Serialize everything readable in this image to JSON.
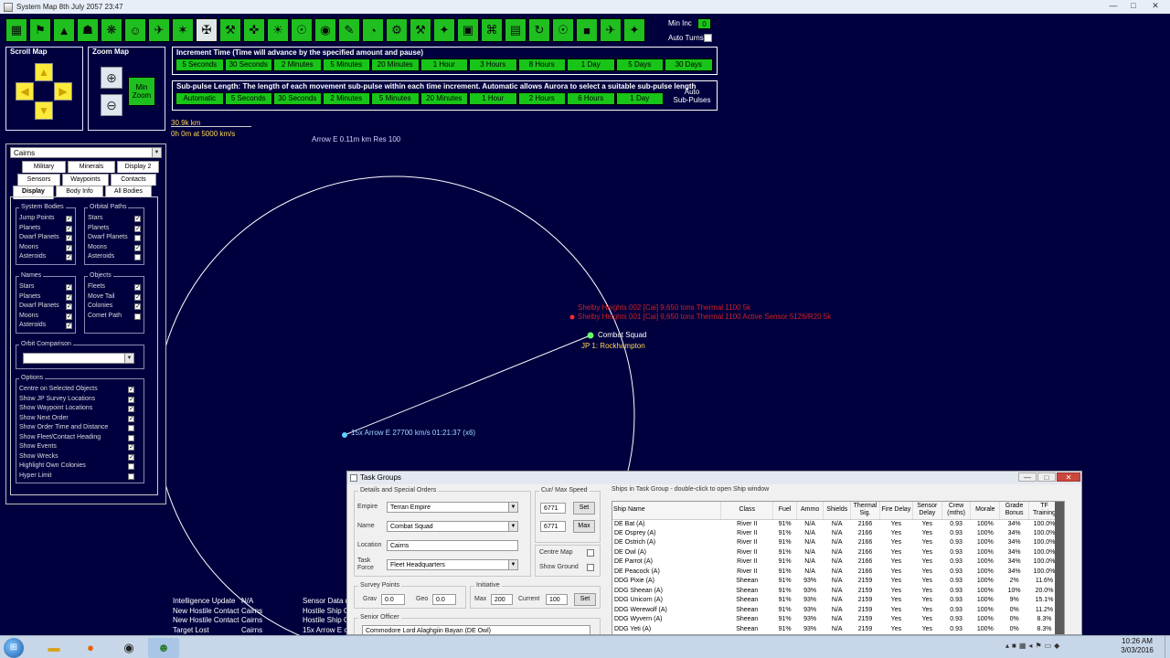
{
  "window": {
    "title": "System Map  8th July 2057 23:47",
    "min_label": "—",
    "max_label": "□",
    "close_label": "✕"
  },
  "toolbar": {
    "icons": [
      "colony-icon",
      "industry-icon",
      "shipyard-icon",
      "research-icon",
      "planet-icon",
      "commander-icon",
      "ship-design-icon",
      "missile-icon",
      "fighter-icon",
      "turret-icon",
      "crosshair-icon",
      "sun-icon",
      "survey-icon",
      "alien-icon",
      "intel-icon",
      "globe-icon",
      "ground-unit-icon",
      "hammer-icon",
      "fleet-icon",
      "class-icon",
      "tech-icon",
      "minerals-icon",
      "events-icon",
      "contacts-icon",
      "pause-icon",
      "fleet-move-icon",
      "theme-icon"
    ],
    "glyphs": [
      "▦",
      "⚑",
      "▲",
      "☗",
      "❋",
      "☺",
      "✈",
      "✶",
      "✠",
      "⚒",
      "✜",
      "☀",
      "☉",
      "◉",
      "✎",
      "◔",
      "⚙",
      "⚒",
      "✦",
      "▣",
      "⌘",
      "▤",
      "↻",
      "☉",
      "■",
      "✈",
      "✦"
    ]
  },
  "min_inc": {
    "label": "Min Inc",
    "value": "0"
  },
  "auto_turns": {
    "label": "Auto Turns"
  },
  "scroll_map": {
    "title": "Scroll Map"
  },
  "zoom_map": {
    "title": "Zoom Map",
    "min_zoom": "Min\nZoom"
  },
  "increment": {
    "title": "Increment Time (Time will advance by the specified amount and pause)",
    "buttons": [
      "5 Seconds",
      "30 Seconds",
      "2 Minutes",
      "5 Minutes",
      "20 Minutes",
      "1 Hour",
      "3 Hours",
      "8 Hours",
      "1 Day",
      "5 Days",
      "30 Days"
    ]
  },
  "subpulse": {
    "title": "Sub-pulse Length: The length of each movement sub-pulse within each time increment. Automatic allows Aurora to select a suitable sub-pulse length",
    "buttons": [
      "Automatic",
      "5 Seconds",
      "30 Seconds",
      "2 Minutes",
      "5 Minutes",
      "20 Minutes",
      "1 Hour",
      "2 Hours",
      "6 Hours",
      "1 Day"
    ],
    "auto_label": "Auto\nSub-Pulses"
  },
  "scale": {
    "distance": "30.9k km",
    "time": "0h 0m at 5000 km/s"
  },
  "map": {
    "arrow_label": "Arrow E  0.11m km  Res 100",
    "contact1": "Shelby Heights 002  [Cai]  9,650 tons  Thermal 1100  5k",
    "contact2": "Shelby Heights 001  [Cai]  9,650 tons  Thermal 1100  Active Sensor 5126/R20  5k",
    "fleet_label": "Combat Squad",
    "jp_label": "JP 1: Rockhampton",
    "missile_label": "15x Arrow E  27700 km/s  01:21:37 (x6)"
  },
  "left_panel": {
    "system": "Cairns",
    "tabs_row1": [
      "Military",
      "Minerals",
      "Display 2"
    ],
    "tabs_row2": [
      "Sensors",
      "Waypoints",
      "Contacts"
    ],
    "tabs_row3": [
      "Display",
      "Body Info",
      "All Bodies"
    ],
    "system_bodies": {
      "title": "System Bodies",
      "items": [
        {
          "label": "Jump Points",
          "checked": true
        },
        {
          "label": "Planets",
          "checked": true
        },
        {
          "label": "Dwarf Planets",
          "checked": true
        },
        {
          "label": "Moons",
          "checked": true
        },
        {
          "label": "Asteroids",
          "checked": true
        }
      ]
    },
    "orbital_paths": {
      "title": "Orbital Paths",
      "items": [
        {
          "label": "Stars",
          "checked": true
        },
        {
          "label": "Planets",
          "checked": true
        },
        {
          "label": "Dwarf Planets",
          "checked": false
        },
        {
          "label": "Moons",
          "checked": true
        },
        {
          "label": "Asteroids",
          "checked": false
        }
      ]
    },
    "names": {
      "title": "Names",
      "items": [
        {
          "label": "Stars",
          "checked": true
        },
        {
          "label": "Planets",
          "checked": true
        },
        {
          "label": "Dwarf Planets",
          "checked": true
        },
        {
          "label": "Moons",
          "checked": true
        },
        {
          "label": "Asteroids",
          "checked": true
        }
      ]
    },
    "objects": {
      "title": "Objects",
      "items": [
        {
          "label": "Fleets",
          "checked": true
        },
        {
          "label": "Move Tail",
          "checked": true
        },
        {
          "label": "Colonies",
          "checked": true
        },
        {
          "label": "Comet Path",
          "checked": false
        }
      ]
    },
    "orbit_comparison": {
      "title": "Orbit Comparison"
    },
    "options": {
      "title": "Options",
      "items": [
        {
          "label": "Centre on Selected Objects",
          "checked": true
        },
        {
          "label": "Show JP Survey Locations",
          "checked": true
        },
        {
          "label": "Show Waypoint Locations",
          "checked": true
        },
        {
          "label": "Show Next Order",
          "checked": true
        },
        {
          "label": "Show Order Time and Distance",
          "checked": false
        },
        {
          "label": "Show Fleet/Contact Heading",
          "checked": false
        },
        {
          "label": "Show Events",
          "checked": true
        },
        {
          "label": "Show Wrecks",
          "checked": true
        },
        {
          "label": "Highlight Own Colonies",
          "checked": false
        },
        {
          "label": "Hyper Limit",
          "checked": false
        }
      ]
    }
  },
  "status_lines": [
    {
      "event": "Intelligence Update",
      "location": "N/A",
      "text": "Sensor Data re"
    },
    {
      "event": "New Hostile Contact",
      "location": "Cairns",
      "text": "Hostile Ship Co"
    },
    {
      "event": "New Hostile Contact",
      "location": "Cairns",
      "text": "Hostile Ship Co"
    },
    {
      "event": "Target Lost",
      "location": "Cairns",
      "text": "15x Arrow E c"
    }
  ],
  "task_groups": {
    "title": "Task Groups",
    "details_title": "Details and Special Orders",
    "empire_label": "Empire",
    "empire": "Terran Empire",
    "name_label": "Name",
    "name": "Combat Squad",
    "location_label": "Location",
    "location": "Cairns",
    "task_force_label": "Task\nForce",
    "task_force": "Fleet Headquarters",
    "speed_title": "Cur/ Max Speed",
    "cur_speed": "6771",
    "max_speed": "6771",
    "set_label": "Set",
    "max_label": "Max",
    "centre_map": "Centre Map",
    "show_ground": "Show Ground",
    "survey_title": "Survey Points",
    "grav_label": "Grav",
    "grav": "0.0",
    "geo_label": "Geo",
    "geo": "0.0",
    "initiative_title": "Initiative",
    "init_max_label": "Max",
    "init_max": "200",
    "init_current_label": "Current",
    "init_current": "100",
    "init_set": "Set",
    "officer_title": "Senior Officer",
    "officer": "Commodore Lord Alaghgiin Bayan  (DE Owl)",
    "ships_title": "Ships in Task Group - double-click to open Ship window",
    "columns": [
      "Ship Name",
      "Class",
      "Fuel",
      "Ammo",
      "Shields",
      "Thermal Sig.",
      "Fire Delay",
      "Sensor Delay",
      "Crew (mths)",
      "Morale",
      "Grade Bonus",
      "TF Training"
    ],
    "rows": [
      [
        "DE Bat (A)",
        "River II",
        "91%",
        "N/A",
        "N/A",
        "2166",
        "Yes",
        "Yes",
        "0.93",
        "100%",
        "34%",
        "100.0%"
      ],
      [
        "DE Osprey (A)",
        "River II",
        "91%",
        "N/A",
        "N/A",
        "2166",
        "Yes",
        "Yes",
        "0.93",
        "100%",
        "34%",
        "100.0%"
      ],
      [
        "DE Ostrich (A)",
        "River II",
        "91%",
        "N/A",
        "N/A",
        "2166",
        "Yes",
        "Yes",
        "0.93",
        "100%",
        "34%",
        "100.0%"
      ],
      [
        "DE Owl (A)",
        "River II",
        "91%",
        "N/A",
        "N/A",
        "2166",
        "Yes",
        "Yes",
        "0.93",
        "100%",
        "34%",
        "100.0%"
      ],
      [
        "DE Parrot (A)",
        "River II",
        "91%",
        "N/A",
        "N/A",
        "2166",
        "Yes",
        "Yes",
        "0.93",
        "100%",
        "34%",
        "100.0%"
      ],
      [
        "DE Peacock (A)",
        "River II",
        "91%",
        "N/A",
        "N/A",
        "2166",
        "Yes",
        "Yes",
        "0.93",
        "100%",
        "34%",
        "100.0%"
      ],
      [
        "DDG Pixie (A)",
        "Sheean",
        "91%",
        "93%",
        "N/A",
        "2159",
        "Yes",
        "Yes",
        "0.93",
        "100%",
        "2%",
        "11.6%"
      ],
      [
        "DDG Sheean (A)",
        "Sheean",
        "91%",
        "93%",
        "N/A",
        "2159",
        "Yes",
        "Yes",
        "0.93",
        "100%",
        "10%",
        "20.0%"
      ],
      [
        "DDG Unicorn (A)",
        "Sheean",
        "91%",
        "93%",
        "N/A",
        "2159",
        "Yes",
        "Yes",
        "0.93",
        "100%",
        "9%",
        "15.1%"
      ],
      [
        "DDG Werewolf (A)",
        "Sheean",
        "91%",
        "93%",
        "N/A",
        "2159",
        "Yes",
        "Yes",
        "0.93",
        "100%",
        "0%",
        "11.2%"
      ],
      [
        "DDG Wyvern (A)",
        "Sheean",
        "91%",
        "93%",
        "N/A",
        "2159",
        "Yes",
        "Yes",
        "0.93",
        "100%",
        "0%",
        "8.3%"
      ],
      [
        "DDG Yeti (A)",
        "Sheean",
        "91%",
        "93%",
        "N/A",
        "2159",
        "Yes",
        "Yes",
        "0.93",
        "100%",
        "0%",
        "8.3%"
      ]
    ]
  },
  "taskbar": {
    "time": "10:26 AM",
    "date": "3/03/2016"
  },
  "colors": {
    "map_bg": "#00003f",
    "button_green": "#19c419",
    "hostile": "#ff2a2a",
    "own_fleet": "#66ff66"
  }
}
